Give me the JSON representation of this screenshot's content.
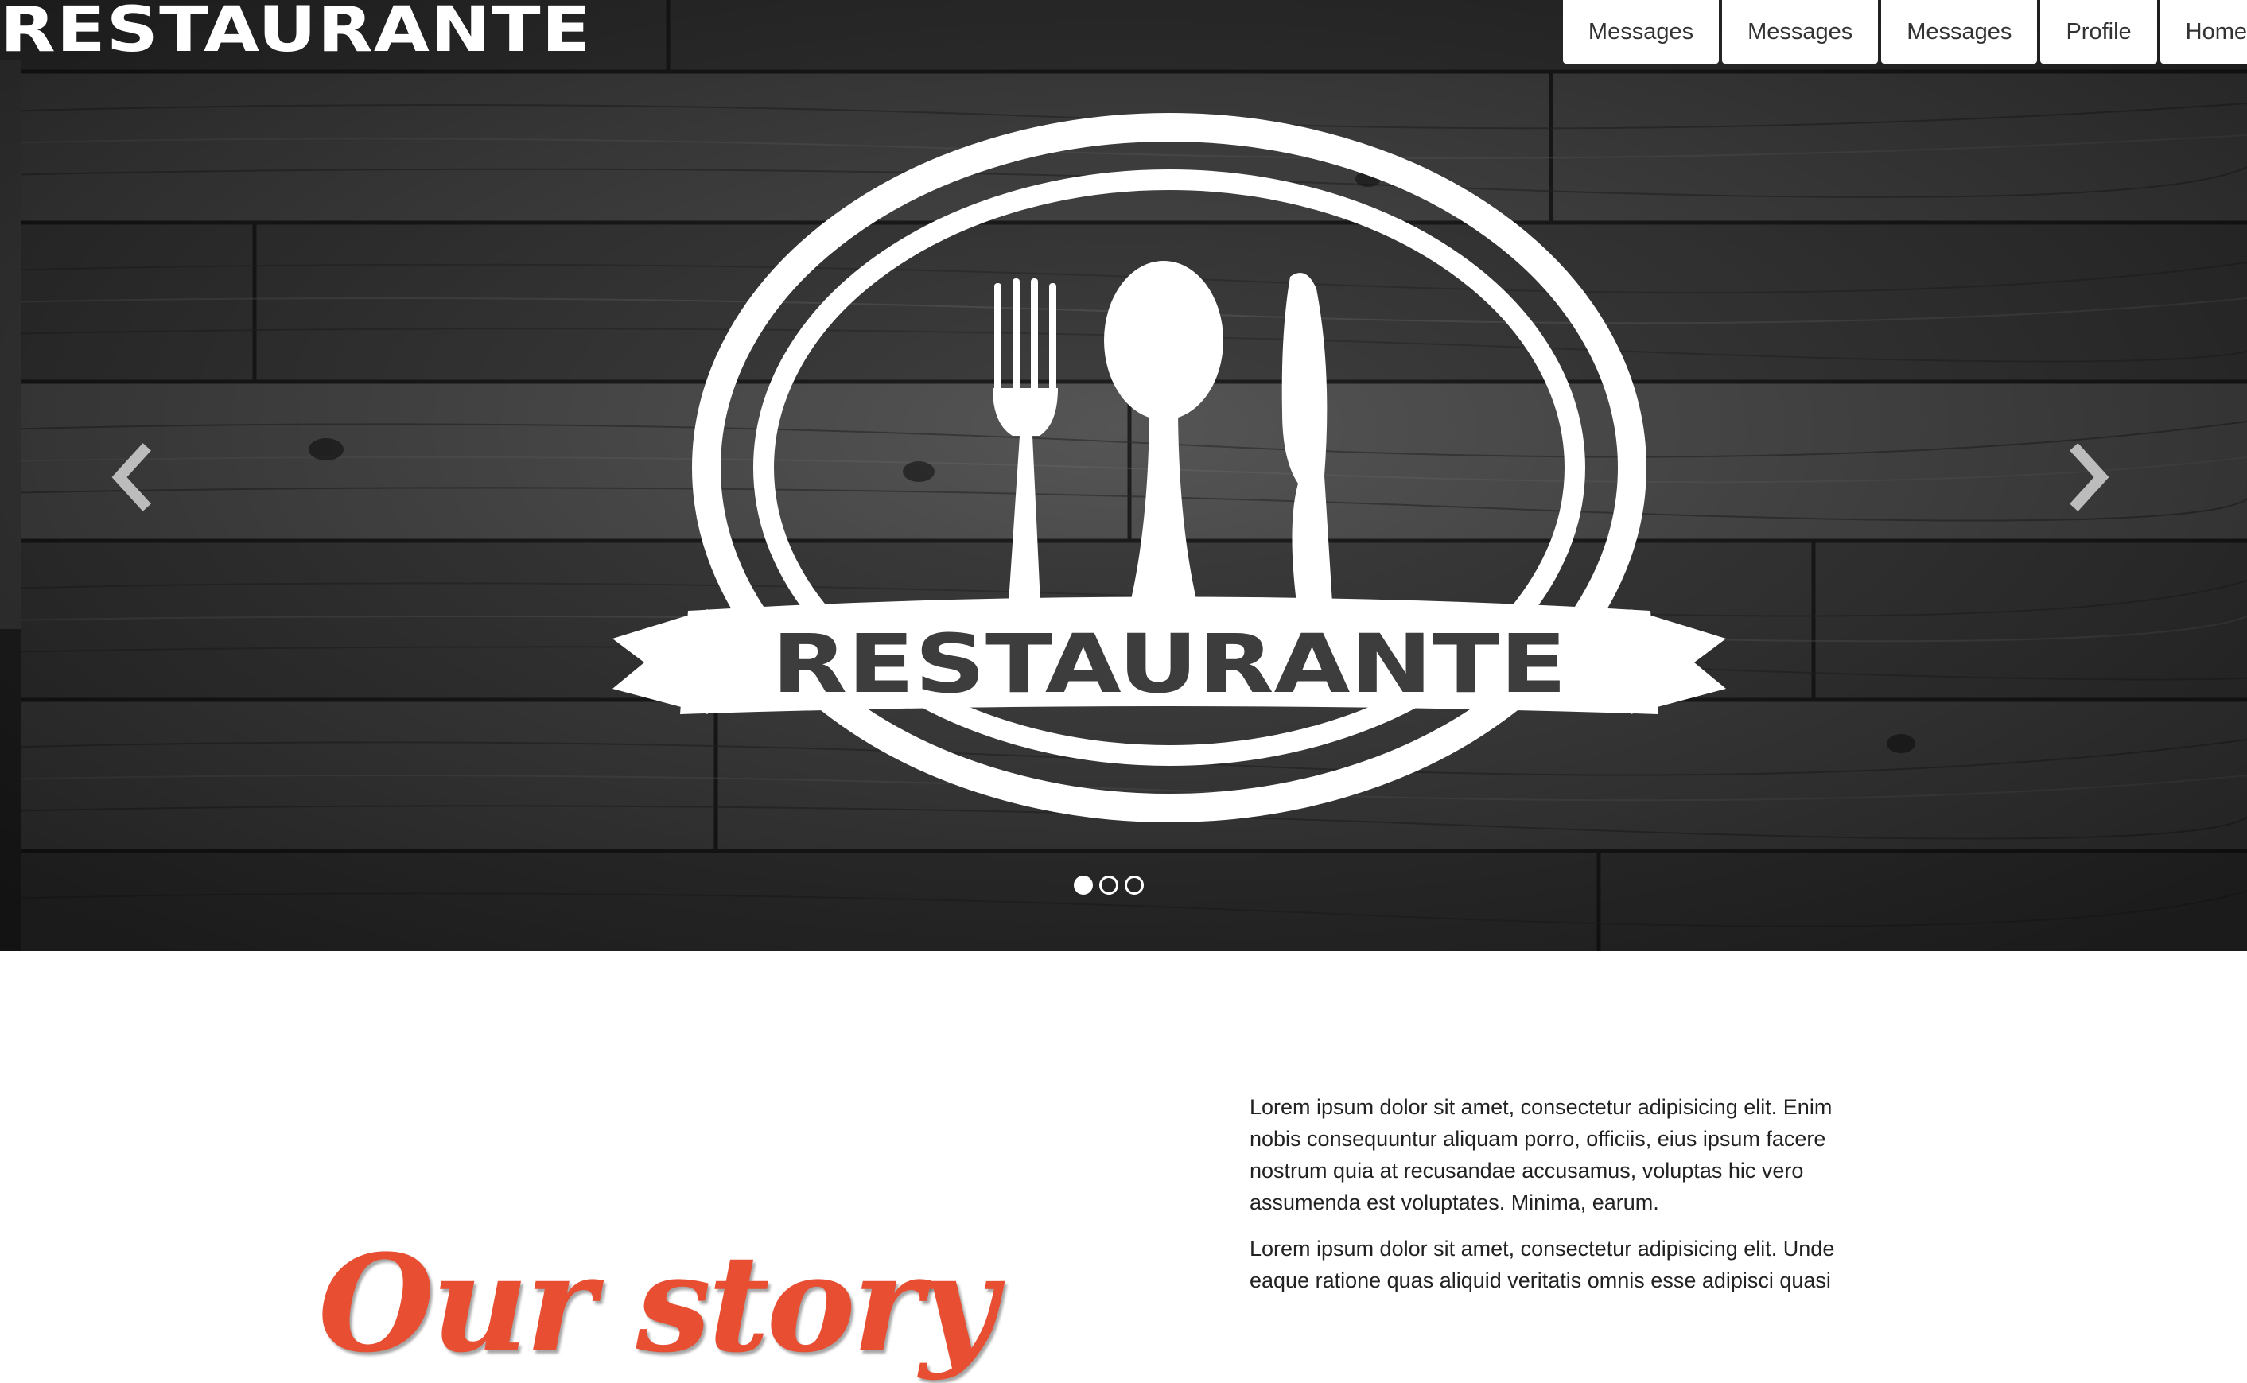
{
  "header": {
    "brand": "RESTAURANTE",
    "nav": [
      "Messages",
      "Messages",
      "Messages",
      "Profile",
      "Home"
    ]
  },
  "carousel": {
    "slide_logo_text": "RESTAURANTE",
    "prev_icon": "chevron-left-icon",
    "next_icon": "chevron-right-icon",
    "slide_count": 3,
    "active_slide": 1
  },
  "story": {
    "title": "Our story",
    "paragraphs": [
      "Lorem ipsum dolor sit amet, consectetur adipisicing elit. Enim nobis consequuntur aliquam porro, officiis, eius ipsum facere nostrum quia at recusandae accusamus, voluptas hic vero assumenda est voluptates. Minima, earum.",
      "Lorem ipsum dolor sit amet, consectetur adipisicing elit. Unde eaque ratione quas aliquid veritatis omnis esse adipisci quasi"
    ]
  },
  "colors": {
    "accent": "#e84f32",
    "hero_bg": "#3b3b3b",
    "nav_bg": "#ffffff",
    "text": "#222222"
  }
}
